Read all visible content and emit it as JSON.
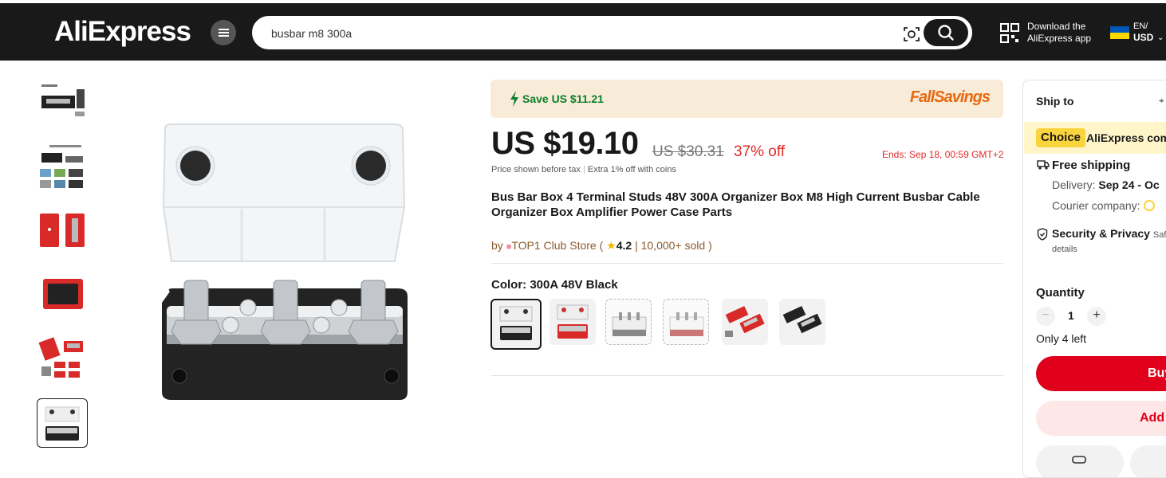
{
  "header": {
    "logo": "AliExpress",
    "search_value": "busbar m8 300a",
    "download_line1": "Download the",
    "download_line2": "AliExpress app",
    "lang": "EN/",
    "currency": "USD"
  },
  "promo": {
    "save_text": "Save US $11.21",
    "campaign": "FallSavings"
  },
  "pricing": {
    "price": "US $19.10",
    "original": "US $30.31",
    "discount": "37% off",
    "ends": "Ends: Sep 18, 00:59 GMT+2",
    "tax_note": "Price shown before tax",
    "coins_note": "Extra 1% off with coins"
  },
  "product": {
    "title": "Bus Bar Box 4 Terminal Studs 48V 300A Organizer Box M8 High Current Busbar Cable Organizer Box Amplifier Power Case Parts",
    "store_prefix": "by",
    "store_name": "TOP1 Club Store",
    "rating": "4.2",
    "sold": "10,000+ sold",
    "color_label": "Color: 300A 48V Black"
  },
  "side": {
    "ship_to": "Ship to",
    "choice_badge": "Choice",
    "choice_text": "AliExpress com",
    "free_shipping": "Free shipping",
    "delivery_label": "Delivery:",
    "delivery_date": "Sep 24 - Oc",
    "courier_label": "Courier company:",
    "security_title": "Security & Privacy",
    "security_sub": "Safe",
    "details": "details",
    "quantity_label": "Quantity",
    "quantity_value": "1",
    "stock": "Only 4 left",
    "buy": "Buy",
    "add": "Add"
  },
  "colors": {
    "accent": "#e0001b",
    "save_green": "#0b7f2b",
    "choice_yellow": "#fad43d"
  }
}
